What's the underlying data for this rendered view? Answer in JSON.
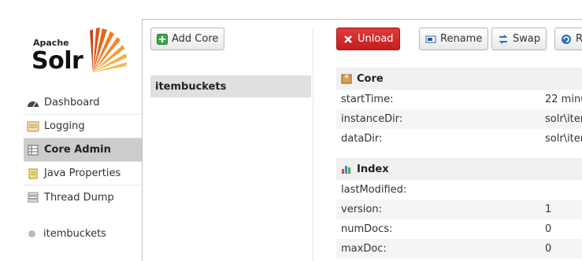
{
  "logo": {
    "apache": "Apache",
    "solr": "Solr"
  },
  "nav": {
    "items": [
      {
        "label": "Dashboard",
        "icon": "dashboard-icon"
      },
      {
        "label": "Logging",
        "icon": "logging-icon"
      },
      {
        "label": "Core Admin",
        "icon": "core-admin-icon"
      },
      {
        "label": "Java Properties",
        "icon": "java-properties-icon"
      },
      {
        "label": "Thread Dump",
        "icon": "thread-dump-icon"
      }
    ],
    "core_selector": "itembuckets"
  },
  "core_list": {
    "add_button": "Add Core",
    "cores": [
      "itembuckets"
    ]
  },
  "toolbar": {
    "unload": "Unload",
    "rename": "Rename",
    "swap": "Swap",
    "reload": "R"
  },
  "sections": {
    "core": {
      "title": "Core",
      "rows": [
        {
          "key": "startTime:",
          "value": "22 minu"
        },
        {
          "key": "instanceDir:",
          "value": "solr\\iten"
        },
        {
          "key": "dataDir:",
          "value": "solr\\iten"
        }
      ]
    },
    "index": {
      "title": "Index",
      "rows": [
        {
          "key": "lastModified:",
          "value": ""
        },
        {
          "key": "version:",
          "value": "1"
        },
        {
          "key": "numDocs:",
          "value": "0"
        },
        {
          "key": "maxDoc:",
          "value": "0"
        }
      ]
    }
  },
  "colors": {
    "unload": "#d42a2b",
    "active_nav": "#cccccc",
    "logo_orange": "#e8661a"
  }
}
